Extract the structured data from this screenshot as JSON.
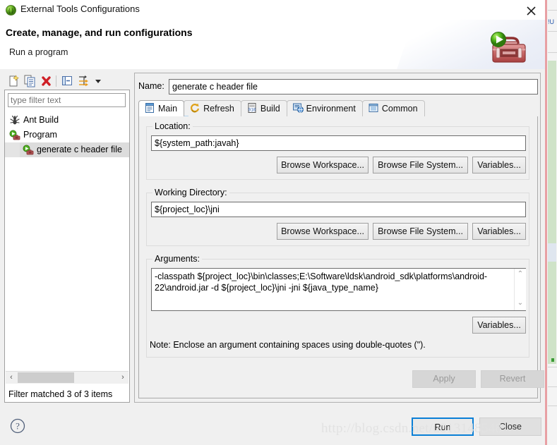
{
  "window": {
    "title": "External Tools Configurations",
    "title_icon": "external-tools-icon",
    "close_label": "×"
  },
  "header": {
    "title": "Create, manage, and run configurations",
    "subtitle": "Run a program",
    "banner_icon": "toolbox-run-icon"
  },
  "left_panel": {
    "toolbar": [
      {
        "name": "new-configuration-icon",
        "tooltip": "New launch configuration"
      },
      {
        "name": "duplicate-configuration-icon",
        "tooltip": "Duplicate"
      },
      {
        "name": "delete-configuration-icon",
        "tooltip": "Delete"
      },
      {
        "name": "collapse-all-icon",
        "tooltip": "Collapse All"
      },
      {
        "name": "filter-icon",
        "tooltip": "Filter launch configurations"
      },
      {
        "name": "view-menu-chevron-icon",
        "tooltip": "View Menu"
      }
    ],
    "filter": {
      "value": "",
      "placeholder": "type filter text"
    },
    "tree": [
      {
        "label": "Ant Build",
        "icon": "ant-icon",
        "level": 0,
        "selected": false
      },
      {
        "label": "Program",
        "icon": "program-icon",
        "level": 0,
        "selected": false
      },
      {
        "label": "generate c header file",
        "icon": "program-icon",
        "level": 1,
        "selected": true
      }
    ],
    "status": "Filter matched 3 of 3 items",
    "hscroll": {
      "left_arrow": "‹",
      "right_arrow": "›"
    }
  },
  "right_panel": {
    "name_label": "Name:",
    "name_value": "generate c header file",
    "tabs": [
      {
        "label": "Main",
        "icon": "main-tab-icon",
        "active": true
      },
      {
        "label": "Refresh",
        "icon": "refresh-tab-icon",
        "active": false
      },
      {
        "label": "Build",
        "icon": "build-tab-icon",
        "active": false
      },
      {
        "label": "Environment",
        "icon": "environment-tab-icon",
        "active": false
      },
      {
        "label": "Common",
        "icon": "common-tab-icon",
        "active": false
      }
    ],
    "location": {
      "group_title": "Location:",
      "value": "${system_path:javah}",
      "buttons": [
        "Browse Workspace...",
        "Browse File System...",
        "Variables..."
      ]
    },
    "working_directory": {
      "group_title": "Working Directory:",
      "value": "${project_loc}\\jni",
      "buttons": [
        "Browse Workspace...",
        "Browse File System...",
        "Variables..."
      ]
    },
    "arguments": {
      "group_title": "Arguments:",
      "value": "-classpath ${project_loc}\\bin\\classes;E:\\Software\\ldsk\\android_sdk\\platforms\\android-22\\android.jar -d ${project_loc}\\jni -jni ${java_type_name}",
      "variables_button": "Variables...",
      "note": "Note: Enclose an argument containing spaces using double-quotes (\").",
      "scroll_up": "⌃",
      "scroll_down": "⌄"
    },
    "apply_label": "Apply",
    "revert_label": "Revert"
  },
  "footer": {
    "help_icon": "help-question-icon",
    "run_label": "Run",
    "close_label": "Close"
  },
  "watermark": "http://blog.csdn.net/u013148548",
  "colors": {
    "accent_blue": "#0a7fd6",
    "tab_active_underline": "#b6d7ef",
    "selection_gray": "#dcdcdc",
    "dialog_bg": "#f0f0f0",
    "green_icon": "#4caf22",
    "red_icon": "#c0392b"
  }
}
